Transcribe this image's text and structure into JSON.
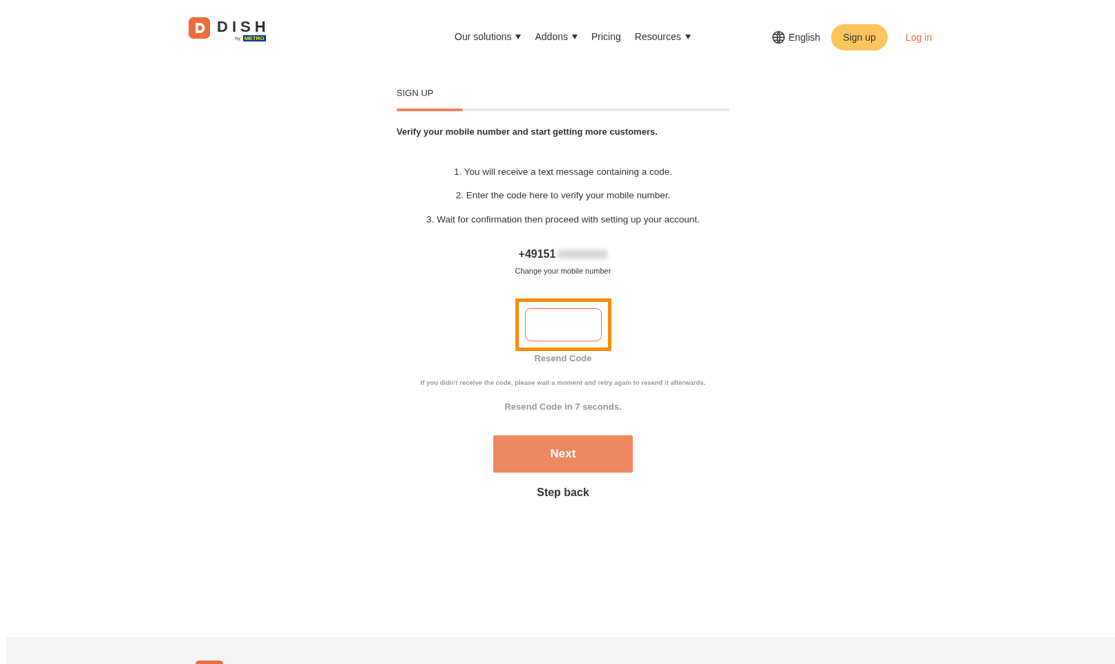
{
  "header": {
    "logo": {
      "wordmark": "DISH",
      "by": "by",
      "brand": "METRO"
    },
    "nav": [
      {
        "label": "Our solutions",
        "dropdown": true
      },
      {
        "label": "Addons",
        "dropdown": true
      },
      {
        "label": "Pricing",
        "dropdown": false
      },
      {
        "label": "Resources",
        "dropdown": true
      }
    ],
    "language": "English",
    "signup": "Sign up",
    "login": "Log in"
  },
  "signup": {
    "step_label": "SIGN UP",
    "progress": {
      "level": 0.2
    },
    "heading": "Verify your mobile number and start getting more customers.",
    "steps": [
      "1. You will receive a text message containing a code.",
      "2. Enter the code here to verify your mobile number.",
      "3. Wait for confirmation then proceed with setting up your account."
    ],
    "phone": {
      "number": "+49151",
      "redacted": true
    },
    "change_number": "Change your mobile number",
    "code_field": {
      "highlighted": true
    },
    "resend": "Resend Code",
    "hint": "If you didn’t receive the code, please wait a moment and retry again to resend it afterwards.",
    "countdown": "Resend Code in 7 seconds.",
    "next": "Next",
    "back": "Step back"
  }
}
